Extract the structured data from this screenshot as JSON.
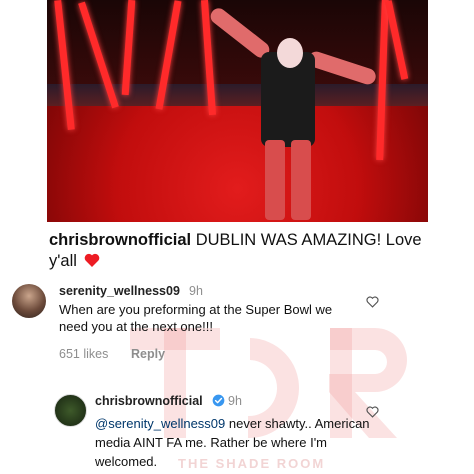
{
  "post": {
    "username": "chrisbrownofficial",
    "caption_text": " DUBLIN WAS AMAZING! Love y'all"
  },
  "comments": [
    {
      "username": "serenity_wellness09",
      "time": "9h",
      "text": "When are you preforming at the Super Bowl we need you at the next one!!!",
      "likes": "651 likes",
      "reply_label": "Reply"
    }
  ],
  "reply": {
    "username": "chrisbrownofficial",
    "time": "9h",
    "mention": "@serenity_wellness09",
    "text": " never shawty.. American media AINT FA me. Rather be where I'm welcomed."
  },
  "watermark": {
    "logo_text": "TSR",
    "subtext": "THE SHADE ROOM"
  },
  "colors": {
    "photo_red": "#c10d0d",
    "heart_red": "#ed1c24",
    "verified_blue": "#3897f0",
    "muted_text": "#8e8e8e"
  },
  "icons": [
    "heart-emoji-icon",
    "like-heart-icon",
    "verified-badge-icon"
  ]
}
